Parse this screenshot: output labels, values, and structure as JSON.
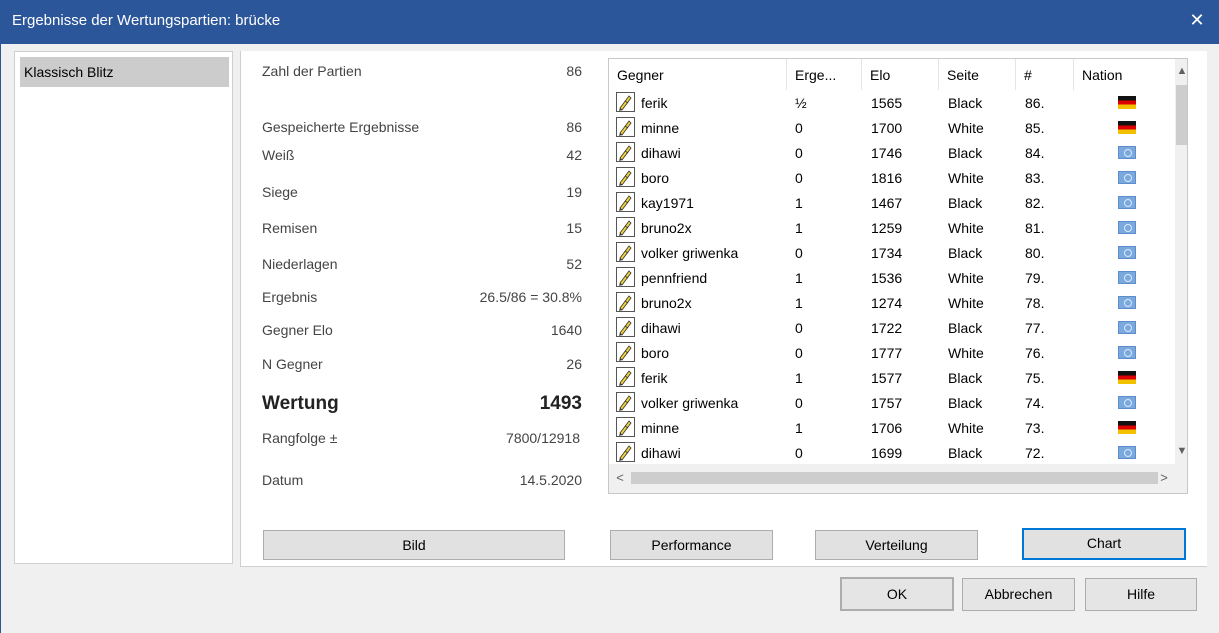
{
  "window": {
    "title": "Ergebnisse der Wertungspartien: brücke",
    "close_glyph": "✕"
  },
  "sidebar": {
    "items": [
      {
        "label": "Klassisch Blitz",
        "selected": true
      }
    ]
  },
  "stats": [
    {
      "label": "Zahl der Partien",
      "value": "86"
    },
    {
      "label": "Gespeicherte Ergebnisse",
      "value": "86"
    },
    {
      "label": "Weiß",
      "value": "42"
    },
    {
      "label": "Siege",
      "value": "19"
    },
    {
      "label": "Remisen",
      "value": "15"
    },
    {
      "label": "Niederlagen",
      "value": "52"
    },
    {
      "label": "Ergebnis",
      "value": "26.5/86 = 30.8%"
    },
    {
      "label": "Gegner Elo",
      "value": "1640"
    },
    {
      "label": "N Gegner",
      "value": "26"
    },
    {
      "label": "Wertung",
      "value": "1493"
    },
    {
      "label": "Rangfolge ±",
      "value": "7800/12918"
    },
    {
      "label": "Datum",
      "value": "14.5.2020"
    }
  ],
  "table": {
    "columns": [
      "Gegner",
      "Erge...",
      "Elo",
      "Seite",
      "#",
      "Nation"
    ],
    "rows": [
      {
        "opponent": "ferik",
        "result": "½",
        "elo": "1565",
        "side": "Black",
        "num": "86.",
        "nation": "de"
      },
      {
        "opponent": "minne",
        "result": "0",
        "elo": "1700",
        "side": "White",
        "num": "85.",
        "nation": "de"
      },
      {
        "opponent": "dihawi",
        "result": "0",
        "elo": "1746",
        "side": "Black",
        "num": "84.",
        "nation": "int"
      },
      {
        "opponent": "boro",
        "result": "0",
        "elo": "1816",
        "side": "White",
        "num": "83.",
        "nation": "int"
      },
      {
        "opponent": "kay1971",
        "result": "1",
        "elo": "1467",
        "side": "Black",
        "num": "82.",
        "nation": "int"
      },
      {
        "opponent": "bruno2x",
        "result": "1",
        "elo": "1259",
        "side": "White",
        "num": "81.",
        "nation": "int"
      },
      {
        "opponent": "volker griwenka",
        "result": "0",
        "elo": "1734",
        "side": "Black",
        "num": "80.",
        "nation": "int"
      },
      {
        "opponent": "pennfriend",
        "result": "1",
        "elo": "1536",
        "side": "White",
        "num": "79.",
        "nation": "int"
      },
      {
        "opponent": "bruno2x",
        "result": "1",
        "elo": "1274",
        "side": "White",
        "num": "78.",
        "nation": "int"
      },
      {
        "opponent": "dihawi",
        "result": "0",
        "elo": "1722",
        "side": "Black",
        "num": "77.",
        "nation": "int"
      },
      {
        "opponent": "boro",
        "result": "0",
        "elo": "1777",
        "side": "White",
        "num": "76.",
        "nation": "int"
      },
      {
        "opponent": "ferik",
        "result": "1",
        "elo": "1577",
        "side": "Black",
        "num": "75.",
        "nation": "de"
      },
      {
        "opponent": "volker griwenka",
        "result": "0",
        "elo": "1757",
        "side": "Black",
        "num": "74.",
        "nation": "int"
      },
      {
        "opponent": "minne",
        "result": "1",
        "elo": "1706",
        "side": "White",
        "num": "73.",
        "nation": "de"
      },
      {
        "opponent": "dihawi",
        "result": "0",
        "elo": "1699",
        "side": "Black",
        "num": "72.",
        "nation": "int"
      }
    ]
  },
  "buttons": {
    "bild": "Bild",
    "performance": "Performance",
    "verteilung": "Verteilung",
    "chart": "Chart",
    "ok": "OK",
    "cancel": "Abbrechen",
    "help": "Hilfe"
  },
  "icons": {
    "row_icon": "pencil-game-icon",
    "scroll_up": "▲",
    "scroll_down": "▼",
    "scroll_left": "<",
    "scroll_right": ">"
  },
  "colors": {
    "titlebar": "#2b579a",
    "focus": "#0078d7"
  }
}
